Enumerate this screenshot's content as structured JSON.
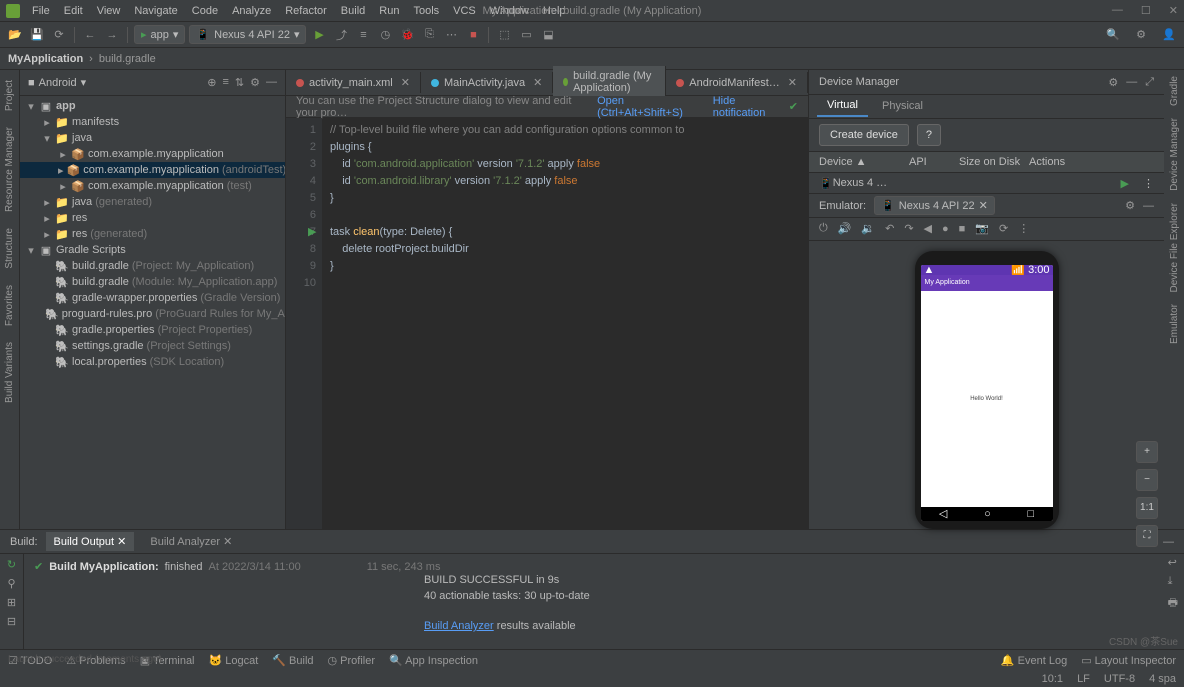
{
  "window": {
    "title": "My Application - build.gradle (My Application)"
  },
  "menu": [
    "File",
    "Edit",
    "View",
    "Navigate",
    "Code",
    "Analyze",
    "Refactor",
    "Build",
    "Run",
    "Tools",
    "VCS",
    "Window",
    "Help"
  ],
  "toolbar": {
    "config": "app",
    "device": "Nexus 4 API 22"
  },
  "breadcrumb": {
    "project": "MyApplication",
    "file": "build.gradle"
  },
  "project": {
    "view": "Android",
    "items": [
      {
        "d": 0,
        "exp": "▾",
        "ico": "mod",
        "label": "app",
        "bold": true
      },
      {
        "d": 1,
        "exp": "▸",
        "ico": "folder",
        "label": "manifests"
      },
      {
        "d": 1,
        "exp": "▾",
        "ico": "folder",
        "label": "java"
      },
      {
        "d": 2,
        "exp": "▸",
        "ico": "pkg",
        "label": "com.example.myapplication"
      },
      {
        "d": 2,
        "exp": "▸",
        "ico": "pkg",
        "label": "com.example.myapplication",
        "hint": "(androidTest)",
        "sel": true
      },
      {
        "d": 2,
        "exp": "▸",
        "ico": "pkg",
        "label": "com.example.myapplication",
        "hint": "(test)"
      },
      {
        "d": 1,
        "exp": "▸",
        "ico": "folder",
        "label": "java",
        "hint": "(generated)"
      },
      {
        "d": 1,
        "exp": "▸",
        "ico": "folder",
        "label": "res"
      },
      {
        "d": 1,
        "exp": "▸",
        "ico": "folder",
        "label": "res",
        "hint": "(generated)"
      },
      {
        "d": 0,
        "exp": "▾",
        "ico": "mod",
        "label": "Gradle Scripts"
      },
      {
        "d": 1,
        "exp": "",
        "ico": "gradle",
        "label": "build.gradle",
        "hint": "(Project: My_Application)"
      },
      {
        "d": 1,
        "exp": "",
        "ico": "gradle",
        "label": "build.gradle",
        "hint": "(Module: My_Application.app)"
      },
      {
        "d": 1,
        "exp": "",
        "ico": "gradle",
        "label": "gradle-wrapper.properties",
        "hint": "(Gradle Version)"
      },
      {
        "d": 1,
        "exp": "",
        "ico": "gradle",
        "label": "proguard-rules.pro",
        "hint": "(ProGuard Rules for My_Appl"
      },
      {
        "d": 1,
        "exp": "",
        "ico": "gradle",
        "label": "gradle.properties",
        "hint": "(Project Properties)"
      },
      {
        "d": 1,
        "exp": "",
        "ico": "gradle",
        "label": "settings.gradle",
        "hint": "(Project Settings)"
      },
      {
        "d": 1,
        "exp": "",
        "ico": "gradle",
        "label": "local.properties",
        "hint": "(SDK Location)"
      }
    ]
  },
  "tabs": [
    {
      "label": "activity_main.xml",
      "color": "#c75450"
    },
    {
      "label": "MainActivity.java",
      "color": "#40b6e0"
    },
    {
      "label": "build.gradle (My Application)",
      "color": "#689f38",
      "active": true
    },
    {
      "label": "AndroidManifest…",
      "color": "#c75450"
    }
  ],
  "infobar": {
    "msg": "You can use the Project Structure dialog to view and edit your pro…",
    "open": "Open (Ctrl+Alt+Shift+S)",
    "hide": "Hide notification"
  },
  "code": {
    "lines": 10,
    "text": [
      {
        "t": "// Top-level build file where you can add configuration options common to ",
        "cls": "cm"
      },
      {
        "t": "plugins {"
      },
      {
        "t": "    id 'com.android.application' version '7.1.2' apply false",
        "rich": true,
        "parts": [
          [
            "    id ",
            ""
          ],
          [
            "'com.android.application'",
            "str"
          ],
          [
            " version ",
            ""
          ],
          [
            "'7.1.2'",
            "str"
          ],
          [
            " apply ",
            ""
          ],
          [
            "false",
            "kw"
          ]
        ]
      },
      {
        "t": "    id 'com.android.library' version '7.1.2' apply false",
        "rich": true,
        "parts": [
          [
            "    id ",
            ""
          ],
          [
            "'com.android.library'",
            "str"
          ],
          [
            " version ",
            ""
          ],
          [
            "'7.1.2'",
            "str"
          ],
          [
            " apply ",
            ""
          ],
          [
            "false",
            "kw"
          ]
        ]
      },
      {
        "t": "}"
      },
      {
        "t": ""
      },
      {
        "t": "task clean(type: Delete) {",
        "rich": true,
        "parts": [
          [
            "task ",
            ""
          ],
          [
            "clean",
            "fn"
          ],
          [
            "(",
            ""
          ],
          [
            "type",
            ""
          ],
          [
            ": Delete) {",
            ""
          ]
        ],
        "run": true
      },
      {
        "t": "    delete rootProject.buildDir"
      },
      {
        "t": "}"
      },
      {
        "t": ""
      }
    ]
  },
  "device": {
    "title": "Device Manager",
    "tabs": [
      "Virtual",
      "Physical"
    ],
    "create": "Create device",
    "cols": [
      "Device ▲",
      "API",
      "Size on Disk",
      "Actions"
    ],
    "row": "Nexus 4 …",
    "emulator_label": "Emulator:",
    "emulator_sel": "Nexus 4 API 22"
  },
  "phone": {
    "status_time": "3:00",
    "app_title": "My Application",
    "hello": "Hello World!"
  },
  "build": {
    "label": "Build:",
    "tabs": [
      "Build Output",
      "Build Analyzer"
    ],
    "task": "Build MyApplication:",
    "status": "finished",
    "at": "At 2022/3/14 11:00",
    "duration": "11 sec, 243 ms",
    "out1": "BUILD SUCCESSFUL in 9s",
    "out2": "40 actionable tasks: 30 up-to-date",
    "analyzer": "Build Analyzer",
    "avail": " results available",
    "launch": "Launch succeeded (moments ago)"
  },
  "status": {
    "tools": [
      "TODO",
      "Problems",
      "Terminal",
      "Logcat",
      "Build",
      "Profiler",
      "App Inspection"
    ],
    "event": "Event Log",
    "inspector": "Layout Inspector",
    "pos": "10:1",
    "lf": "LF",
    "enc": "UTF-8",
    "indent": "4 spa"
  },
  "rails": {
    "left": [
      "Project",
      "Resource Manager",
      "Structure",
      "Favorites",
      "Build Variants"
    ],
    "right": [
      "Gradle",
      "Device Manager",
      "Device File Explorer",
      "Emulator"
    ]
  },
  "watermark": "CSDN @茶Sue"
}
